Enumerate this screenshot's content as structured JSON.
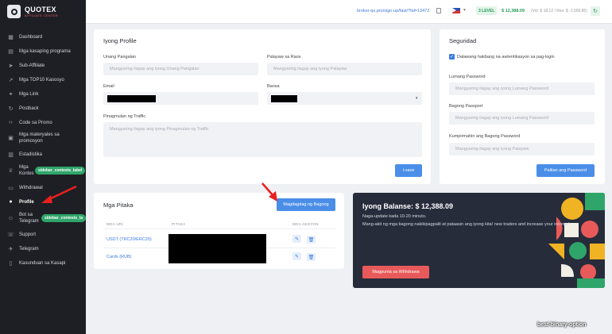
{
  "brand": {
    "title": "QUOTEX",
    "subtitle": "AFFILIATE CENTER"
  },
  "sidebar": {
    "items": [
      {
        "label": "Dashboard",
        "icon": "grid-icon"
      },
      {
        "label": "Mga kasaping programa",
        "icon": "folder-icon"
      },
      {
        "label": "Sub-Affiliate",
        "icon": "send-icon"
      },
      {
        "label": "Mga TOP10 Kasosyo",
        "icon": "trend-icon"
      },
      {
        "label": "Mga Link",
        "icon": "link-icon"
      },
      {
        "label": "Postback",
        "icon": "refresh-icon"
      },
      {
        "label": "Code sa Promo",
        "icon": "code-icon"
      },
      {
        "label": "Mga materyales sa promosyon",
        "icon": "image-icon"
      },
      {
        "label": "Estadistika",
        "icon": "chart-icon"
      },
      {
        "label": "Mga Kontes",
        "icon": "trophy-icon"
      },
      {
        "label": "Withdrawal",
        "icon": "wallet-icon"
      },
      {
        "label": "Profile",
        "icon": "user-icon"
      },
      {
        "label": "Bot sa Telegram",
        "icon": "bot-icon"
      },
      {
        "label": "Support",
        "icon": "support-icon"
      },
      {
        "label": "Telegram",
        "icon": "telegram-icon"
      },
      {
        "label": "Kasunduan sa Kasapi",
        "icon": "document-icon"
      }
    ],
    "tag_contests": "sidebar_contests_label",
    "tag_bot": "sidebar_contests_la"
  },
  "topbar": {
    "ref_link": "broker-qx.pro/sign-up/fast/?lid=13472",
    "level": "3 LEVEL",
    "balance": "$ 12,388.09",
    "balance_detail": "(Vol: $ 18.12 / Rev: $ -1,009.85)"
  },
  "profile": {
    "title": "Iyong Profile",
    "first_name_label": "Unang Pangalan",
    "first_name_placeholder": "Mangyaring ilagay ang iyong Unang Pangalan",
    "last_name_label": "Palayaw sa Raos",
    "last_name_placeholder": "Mangyaring ilagay ang iyong Palayaw",
    "email_label": "Email",
    "country_label": "Bansa",
    "traffic_label": "Pinagmulan ng Traffic",
    "traffic_placeholder": "Mangyaring ilagay ang iyong Pinagmulan ng Traffic",
    "save_label": "I-save"
  },
  "security": {
    "title": "Seguridad",
    "twofa_label": "Dalawang hakbang na awtentikasyon sa pag-login",
    "current_label": "Lumang Password",
    "current_placeholder": "Mangyaring ilagay ang iyong Lumang Password",
    "new_label": "Bagong Passport",
    "new_placeholder": "Mangyaring ilagay ang iyong Lumang Password",
    "confirm_label": "Kumpirmahin ang Bagong Password",
    "confirm_placeholder": "Mangyaring ilagay ang iyong Palayaw",
    "change_label": "Palitan ang Password"
  },
  "wallets": {
    "title": "Mga Pitaka",
    "add_label": "Magdagdag ng Bagong",
    "headers": {
      "type": "MGA URI",
      "wallet": "PITAKA",
      "action": "MGA AKSYON"
    },
    "rows": [
      {
        "type": "USDT (TRC20/ERC20)"
      },
      {
        "type": "Cards (RUB)"
      }
    ]
  },
  "balance": {
    "title": "Iyong Balanse: $ 12,388.09",
    "line1": "Naga-update kada 10-20 minuto.",
    "line2": "Mang-akit ng mga bagong nakikipagpalit at pataasin ang iyong kita! new traders and increase your income!",
    "button": "Magpunta sa Withdrawa"
  },
  "watermark": "best-binary-option",
  "colors": {
    "sidebar": "#1e1f25",
    "accent": "#4a8ee8",
    "success": "#2fa56a",
    "danger": "#e85a5a",
    "arrow": "#e8201e"
  }
}
